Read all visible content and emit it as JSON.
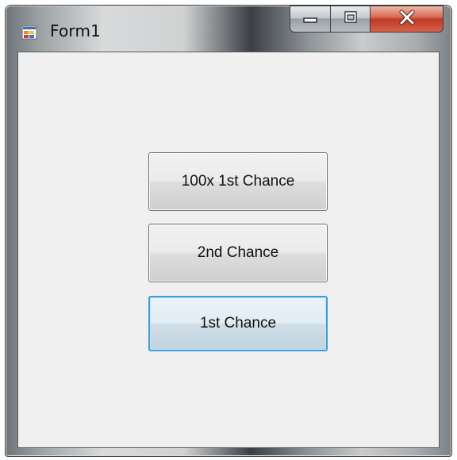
{
  "window": {
    "title": "Form1"
  },
  "caption_buttons": {
    "minimize": "minimize-icon",
    "maximize": "maximize-icon",
    "close": "close-icon"
  },
  "buttons": [
    {
      "label": "100x 1st Chance"
    },
    {
      "label": "2nd Chance"
    },
    {
      "label": "1st Chance",
      "focused": true
    }
  ],
  "colors": {
    "client_background": "#f0f0f0",
    "focus_border": "#3c9fd8",
    "close_button": "#c13a25"
  }
}
